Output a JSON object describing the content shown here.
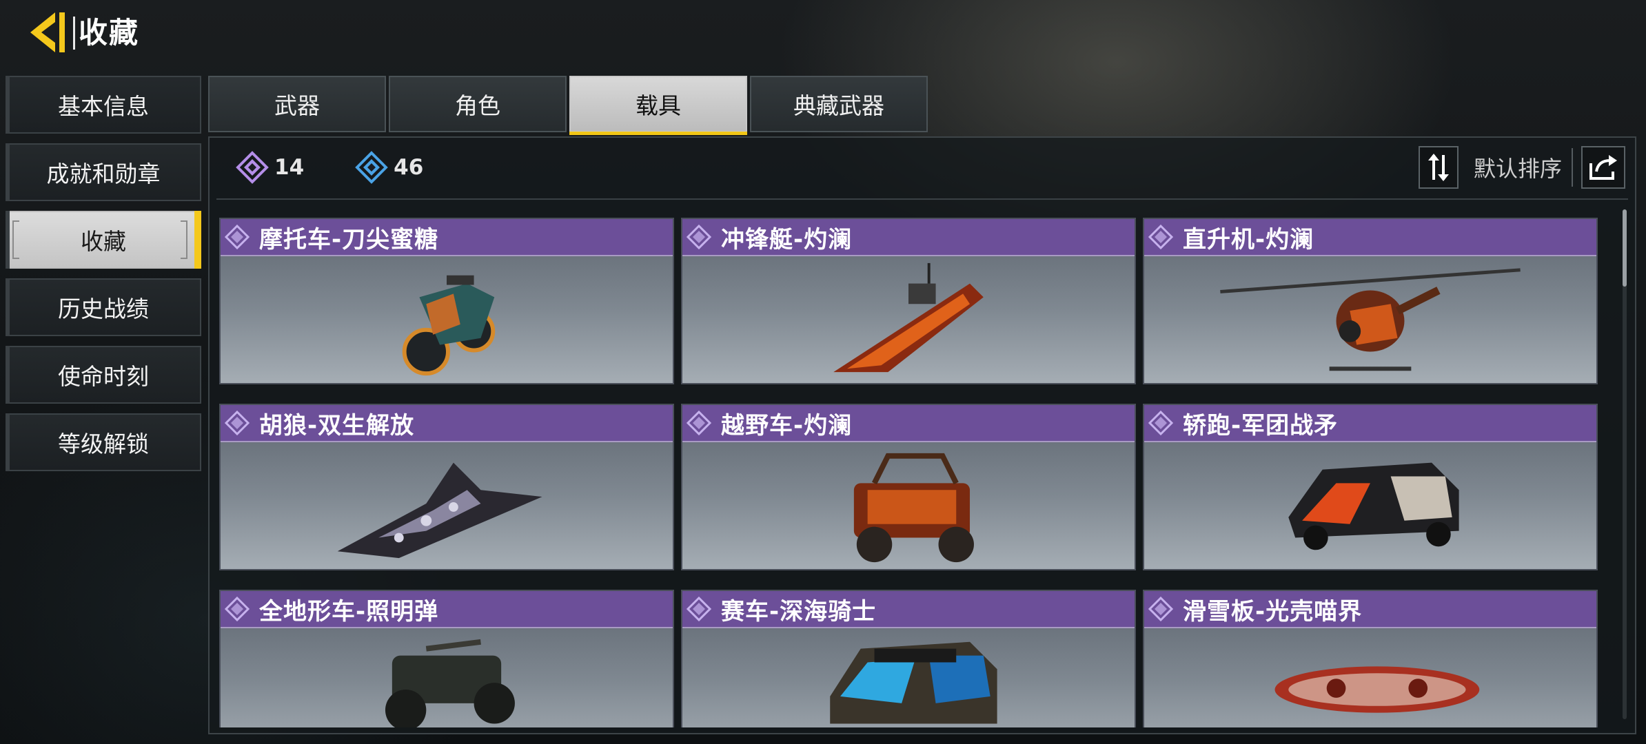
{
  "header": {
    "title": "收藏",
    "back_icon": "back-arrow-icon"
  },
  "sidebar": {
    "items": [
      {
        "label": "基本信息",
        "active": false
      },
      {
        "label": "成就和勋章",
        "active": false
      },
      {
        "label": "收藏",
        "active": true
      },
      {
        "label": "历史战绩",
        "active": false
      },
      {
        "label": "使命时刻",
        "active": false
      },
      {
        "label": "等级解锁",
        "active": false
      }
    ]
  },
  "tabs": [
    {
      "label": "武器",
      "active": false
    },
    {
      "label": "角色",
      "active": false
    },
    {
      "label": "载具",
      "active": true
    },
    {
      "label": "典藏武器",
      "active": false
    }
  ],
  "stats": {
    "purple_count": "14",
    "blue_count": "46"
  },
  "sort": {
    "label": "默认排序",
    "sort_icon": "sort-swap-icon",
    "share_icon": "share-icon"
  },
  "colors": {
    "accent": "#f2c617",
    "card_header": "#6c4f99",
    "purple_diamond": "#b48ee8",
    "blue_diamond": "#4aa3e6"
  },
  "vehicles": [
    {
      "name": "摩托车-刀尖蜜糖",
      "icon": "motorcycle-icon"
    },
    {
      "name": "冲锋艇-灼澜",
      "icon": "speedboat-icon"
    },
    {
      "name": "直升机-灼澜",
      "icon": "helicopter-icon"
    },
    {
      "name": "胡狼-双生解放",
      "icon": "jet-icon"
    },
    {
      "name": "越野车-灼澜",
      "icon": "offroad-buggy-icon"
    },
    {
      "name": "轿跑-军团战矛",
      "icon": "sports-car-icon"
    },
    {
      "name": "全地形车-照明弹",
      "icon": "atv-icon"
    },
    {
      "name": "赛车-深海骑士",
      "icon": "rally-car-icon"
    },
    {
      "name": "滑雪板-光壳喵界",
      "icon": "snowboard-icon"
    }
  ]
}
